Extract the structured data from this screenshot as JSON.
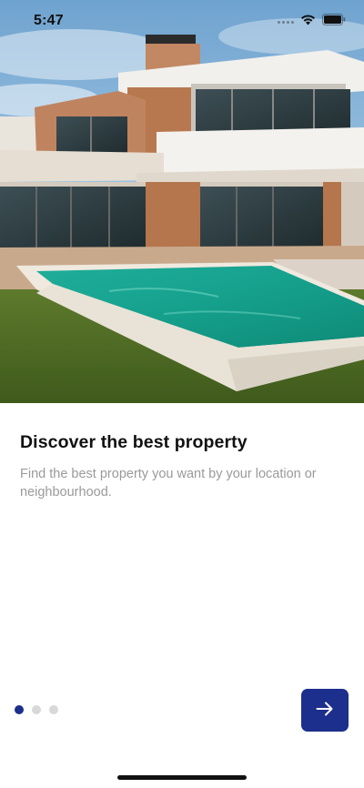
{
  "status_bar": {
    "time": "5:47",
    "icons": [
      "signal-dots-icon",
      "wifi-icon",
      "battery-icon"
    ]
  },
  "hero": {
    "image": "modern-house-with-swimming-pool"
  },
  "onboarding": {
    "title": "Discover the best property",
    "description": "Find the best property you want by your location or neighbourhood.",
    "page_index": 1,
    "page_count": 3
  },
  "next_button": {
    "icon": "arrow-right-icon"
  },
  "colors": {
    "accent": "#1c2f8c",
    "inactive_dot": "#d8d8d8",
    "title": "#111111",
    "description": "#9a9a9a"
  }
}
